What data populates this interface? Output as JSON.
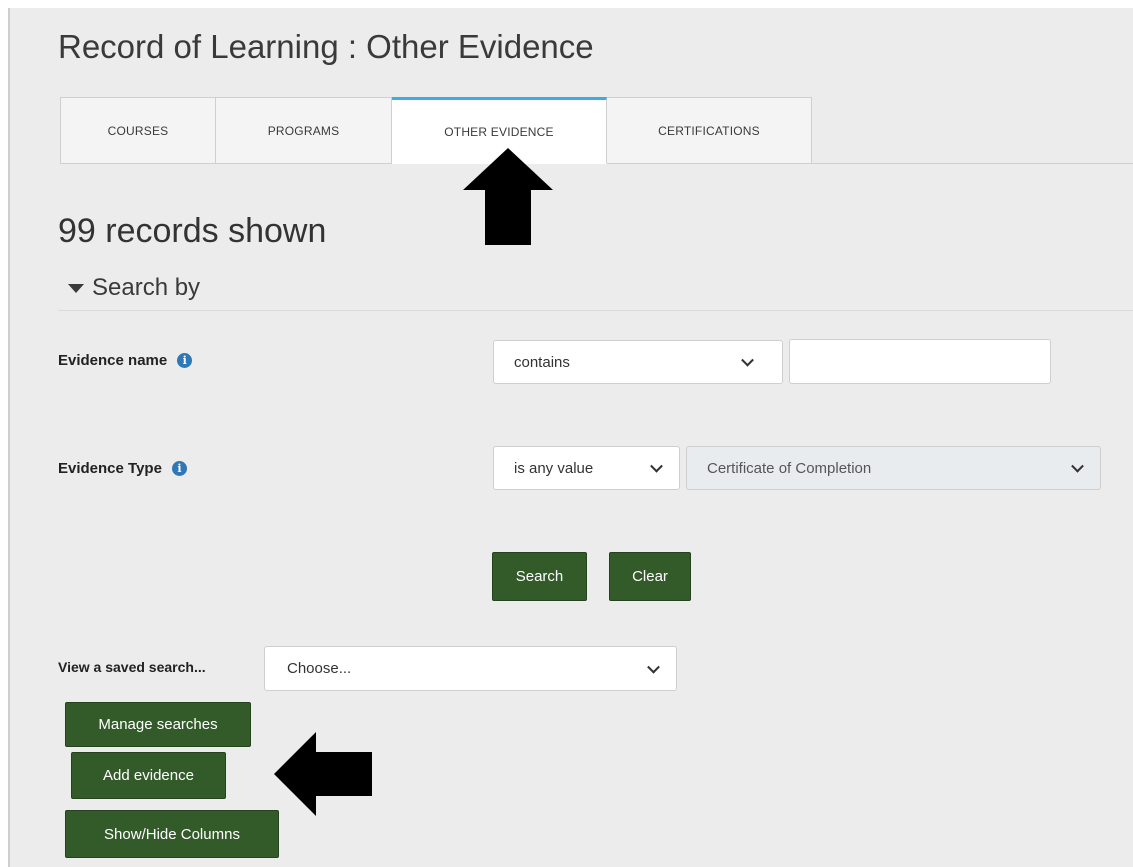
{
  "header": {
    "title": "Record of Learning : Other Evidence"
  },
  "tabs": [
    {
      "label": "COURSES"
    },
    {
      "label": "PROGRAMS"
    },
    {
      "label": "OTHER EVIDENCE"
    },
    {
      "label": "CERTIFICATIONS"
    }
  ],
  "results": {
    "records_text": "99 records shown"
  },
  "search": {
    "toggle_label": "Search by",
    "evidence_name": {
      "label": "Evidence name",
      "operator": "contains",
      "value": ""
    },
    "evidence_type": {
      "label": "Evidence Type",
      "operator": "is any value",
      "value": "Certificate of Completion"
    },
    "search_button": "Search",
    "clear_button": "Clear"
  },
  "saved_search": {
    "label": "View a saved search...",
    "selected": "Choose..."
  },
  "actions": {
    "manage_searches": "Manage searches",
    "add_evidence": "Add evidence",
    "show_hide_columns": "Show/Hide Columns"
  },
  "colors": {
    "button": "#335b2a",
    "active_tab_border": "#3aaee0",
    "info_icon": "#2f78b5"
  },
  "icons": [
    "info-icon",
    "caret-down-icon",
    "chevron-down-icon",
    "arrow-up-icon",
    "arrow-left-icon"
  ]
}
